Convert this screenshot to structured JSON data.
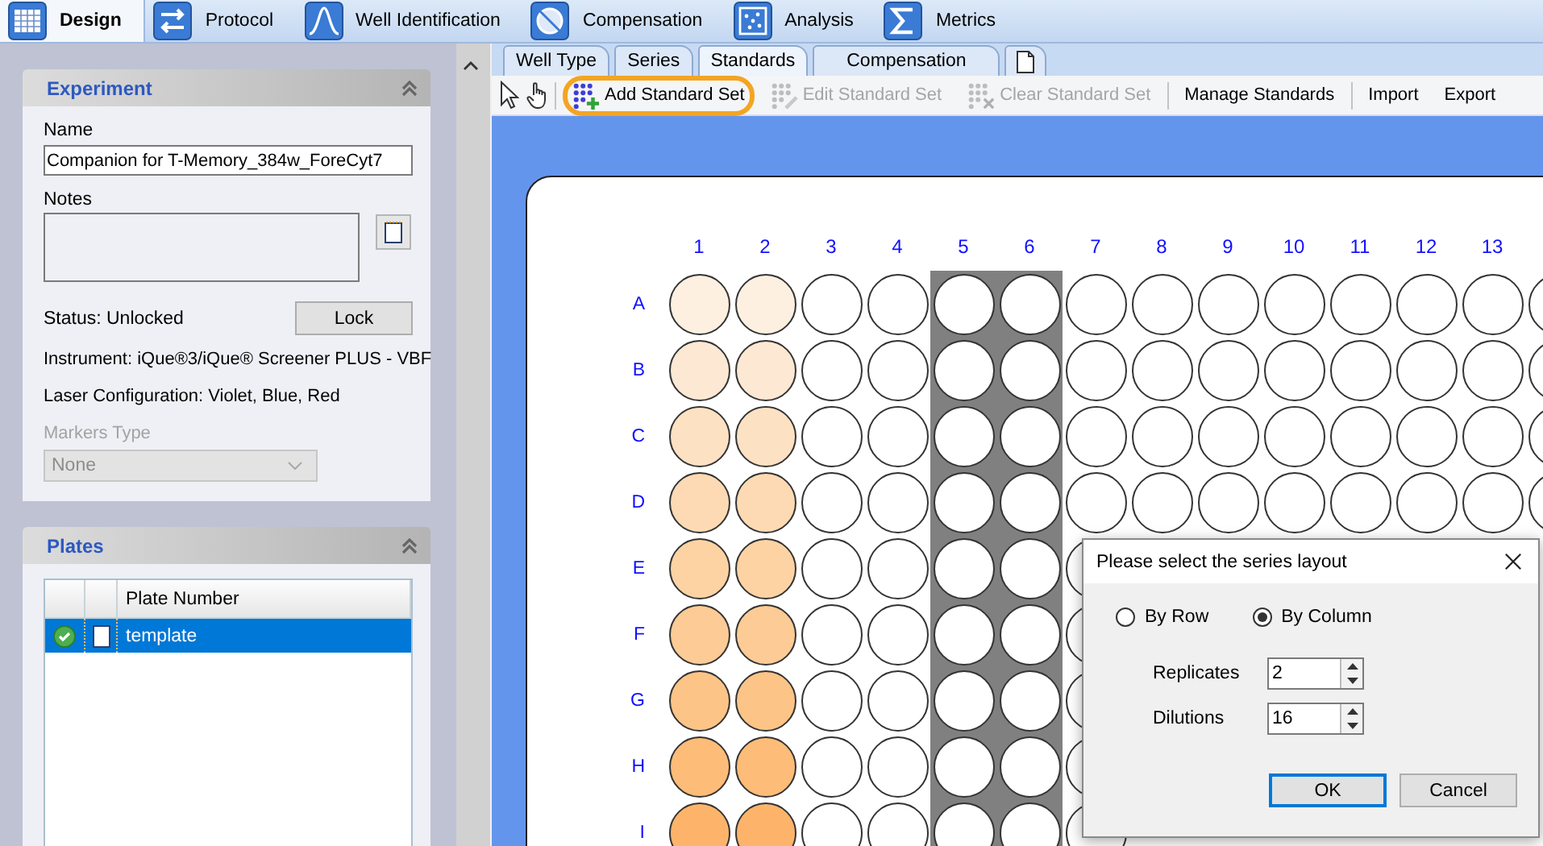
{
  "top_tabs": [
    {
      "label": "Design",
      "selected": true,
      "kind": "grid"
    },
    {
      "label": "Protocol",
      "selected": false,
      "kind": "arrows"
    },
    {
      "label": "Well Identification",
      "selected": false,
      "kind": "peak"
    },
    {
      "label": "Compensation",
      "selected": false,
      "kind": "ellipse"
    },
    {
      "label": "Analysis",
      "selected": false,
      "kind": "scatter"
    },
    {
      "label": "Metrics",
      "selected": false,
      "kind": "sigma"
    }
  ],
  "experiment": {
    "title": "Experiment",
    "name_label": "Name",
    "name_value": "Companion for T-Memory_384w_ForeCyt7",
    "notes_label": "Notes",
    "status": "Status: Unlocked",
    "lock_button": "Lock",
    "instrument": "Instrument: iQue®3/iQue® Screener PLUS - VBF",
    "laser": "Laser Configuration: Violet, Blue, Red",
    "markers_label": "Markers Type",
    "markers_value": "None",
    "markers_disabled": true
  },
  "plates": {
    "title": "Plates",
    "column": "Plate Number",
    "rows": [
      {
        "name": "template",
        "selected": true
      }
    ]
  },
  "sub_tabs": [
    {
      "label": "Well Type",
      "selected": false
    },
    {
      "label": "Series",
      "selected": false
    },
    {
      "label": "Standards",
      "selected": true
    },
    {
      "label": "Compensation",
      "selected": false
    }
  ],
  "toolbar": [
    {
      "kind": "pointer"
    },
    {
      "kind": "hand"
    },
    {
      "kind": "separator"
    },
    {
      "kind": "add",
      "label": "Add Standard Set",
      "disabled": false,
      "highlighted": true
    },
    {
      "kind": "edit",
      "label": "Edit Standard Set",
      "disabled": true,
      "highlighted": false
    },
    {
      "kind": "clear",
      "label": "Clear Standard Set",
      "disabled": true,
      "highlighted": false
    },
    {
      "kind": "separator"
    },
    {
      "kind": "button",
      "label": "Manage Standards",
      "disabled": false,
      "highlighted": false
    },
    {
      "kind": "separator"
    },
    {
      "kind": "button",
      "label": "Import",
      "disabled": false,
      "highlighted": false
    },
    {
      "kind": "button",
      "label": "Export",
      "disabled": false,
      "highlighted": false
    }
  ],
  "plate": {
    "columns": [
      {
        "label": "1",
        "selected": false
      },
      {
        "label": "2",
        "selected": false
      },
      {
        "label": "3",
        "selected": false
      },
      {
        "label": "4",
        "selected": false
      },
      {
        "label": "5",
        "selected": true
      },
      {
        "label": "6",
        "selected": true
      },
      {
        "label": "7",
        "selected": false
      },
      {
        "label": "8",
        "selected": false
      },
      {
        "label": "9",
        "selected": false
      },
      {
        "label": "10",
        "selected": false
      },
      {
        "label": "11",
        "selected": false
      },
      {
        "label": "12",
        "selected": false
      },
      {
        "label": "13",
        "selected": false
      }
    ],
    "rows": [
      {
        "label": "A",
        "wells": [
          {
            "color": "#fdf0e1"
          },
          {
            "color": "#fdf0e1"
          },
          {
            "color": "#ffffff"
          },
          {
            "color": "#ffffff"
          },
          {
            "color": "#ffffff"
          },
          {
            "color": "#ffffff"
          },
          {
            "color": "#ffffff"
          },
          {
            "color": "#ffffff"
          },
          {
            "color": "#ffffff"
          },
          {
            "color": "#ffffff"
          },
          {
            "color": "#ffffff"
          },
          {
            "color": "#ffffff"
          },
          {
            "color": "#ffffff"
          },
          {
            "color": "#ffffff"
          }
        ]
      },
      {
        "label": "B",
        "wells": [
          {
            "color": "#fde8d3"
          },
          {
            "color": "#fde8d3"
          },
          {
            "color": "#ffffff"
          },
          {
            "color": "#ffffff"
          },
          {
            "color": "#ffffff"
          },
          {
            "color": "#ffffff"
          },
          {
            "color": "#ffffff"
          },
          {
            "color": "#ffffff"
          },
          {
            "color": "#ffffff"
          },
          {
            "color": "#ffffff"
          },
          {
            "color": "#ffffff"
          },
          {
            "color": "#ffffff"
          },
          {
            "color": "#ffffff"
          },
          {
            "color": "#ffffff"
          }
        ]
      },
      {
        "label": "C",
        "wells": [
          {
            "color": "#fde1c3"
          },
          {
            "color": "#fde1c3"
          },
          {
            "color": "#ffffff"
          },
          {
            "color": "#ffffff"
          },
          {
            "color": "#ffffff"
          },
          {
            "color": "#ffffff"
          },
          {
            "color": "#ffffff"
          },
          {
            "color": "#ffffff"
          },
          {
            "color": "#ffffff"
          },
          {
            "color": "#ffffff"
          },
          {
            "color": "#ffffff"
          },
          {
            "color": "#ffffff"
          },
          {
            "color": "#ffffff"
          },
          {
            "color": "#ffffff"
          }
        ]
      },
      {
        "label": "D",
        "wells": [
          {
            "color": "#fddab3"
          },
          {
            "color": "#fddab3"
          },
          {
            "color": "#ffffff"
          },
          {
            "color": "#ffffff"
          },
          {
            "color": "#ffffff"
          },
          {
            "color": "#ffffff"
          },
          {
            "color": "#ffffff"
          },
          {
            "color": "#ffffff"
          },
          {
            "color": "#ffffff"
          },
          {
            "color": "#ffffff"
          },
          {
            "color": "#ffffff"
          },
          {
            "color": "#ffffff"
          },
          {
            "color": "#ffffff"
          },
          {
            "color": "#ffffff"
          }
        ]
      },
      {
        "label": "E",
        "wells": [
          {
            "color": "#fdd3a4"
          },
          {
            "color": "#fdd3a4"
          },
          {
            "color": "#ffffff"
          },
          {
            "color": "#ffffff"
          },
          {
            "color": "#ffffff"
          },
          {
            "color": "#ffffff"
          },
          {
            "color": "#ffffff"
          }
        ]
      },
      {
        "label": "F",
        "wells": [
          {
            "color": "#fdcb95"
          },
          {
            "color": "#fdcb95"
          },
          {
            "color": "#ffffff"
          },
          {
            "color": "#ffffff"
          },
          {
            "color": "#ffffff"
          },
          {
            "color": "#ffffff"
          },
          {
            "color": "#ffffff"
          }
        ]
      },
      {
        "label": "G",
        "wells": [
          {
            "color": "#fdc487"
          },
          {
            "color": "#fdc487"
          },
          {
            "color": "#ffffff"
          },
          {
            "color": "#ffffff"
          },
          {
            "color": "#ffffff"
          },
          {
            "color": "#ffffff"
          },
          {
            "color": "#ffffff"
          }
        ]
      },
      {
        "label": "H",
        "wells": [
          {
            "color": "#fdbc78"
          },
          {
            "color": "#fdbc78"
          },
          {
            "color": "#ffffff"
          },
          {
            "color": "#ffffff"
          },
          {
            "color": "#ffffff"
          },
          {
            "color": "#ffffff"
          },
          {
            "color": "#ffffff"
          }
        ]
      },
      {
        "label": "I",
        "wells": [
          {
            "color": "#fdb46a"
          },
          {
            "color": "#fdb46a"
          },
          {
            "color": "#ffffff"
          },
          {
            "color": "#ffffff"
          },
          {
            "color": "#ffffff"
          },
          {
            "color": "#ffffff"
          },
          {
            "color": "#ffffff"
          }
        ]
      }
    ]
  },
  "dialog": {
    "title": "Please select the series layout",
    "layout_options": [
      {
        "label": "By Row",
        "selected": false
      },
      {
        "label": "By Column",
        "selected": true
      }
    ],
    "fields": [
      {
        "label": "Replicates",
        "value": "2"
      },
      {
        "label": "Dilutions",
        "value": "16"
      }
    ],
    "buttons": [
      {
        "label": "OK",
        "default": true
      },
      {
        "label": "Cancel",
        "default": false
      }
    ]
  }
}
